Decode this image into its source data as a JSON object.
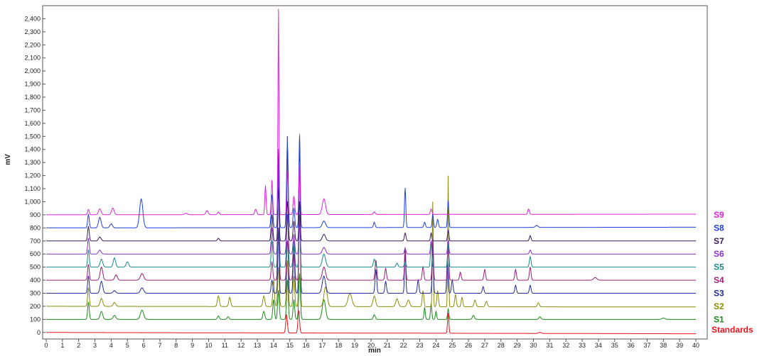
{
  "chart_data": {
    "type": "line",
    "title": "",
    "xlabel": "min",
    "ylabel": "mV",
    "xlim": [
      0,
      40
    ],
    "ylim": [
      -50,
      2500
    ],
    "x_ticks": [
      0,
      1,
      2,
      3,
      4,
      5,
      6,
      7,
      8,
      9,
      10,
      11,
      12,
      13,
      14,
      15,
      16,
      17,
      18,
      19,
      20,
      21,
      22,
      23,
      24,
      25,
      26,
      27,
      28,
      29,
      30,
      31,
      32,
      33,
      34,
      35,
      36,
      37,
      38,
      39,
      40
    ],
    "y_ticks": [
      0,
      100,
      200,
      300,
      400,
      500,
      600,
      700,
      800,
      900,
      1000,
      1100,
      1200,
      1300,
      1400,
      1500,
      1600,
      1700,
      1800,
      1900,
      2000,
      2100,
      2200,
      2300,
      2400
    ],
    "y_tick_labels": [
      "0",
      "100",
      "200",
      "300",
      "400",
      "500",
      "600",
      "700",
      "800",
      "900",
      "1,000",
      "1,100",
      "1,200",
      "1,300",
      "1,400",
      "1,500",
      "1,600",
      "1,700",
      "1,800",
      "1,900",
      "2,000",
      "2,100",
      "2,200",
      "2,300",
      "2,400"
    ],
    "grid": false,
    "legend_placement": "right, at each trace baseline",
    "series": [
      {
        "name": "Standards",
        "color": "#e8141e",
        "baseline": 0,
        "end": -10,
        "peaks": [
          [
            14.8,
            140,
            0.05
          ],
          [
            15.55,
            170,
            0.05
          ],
          [
            24.75,
            150,
            0.04
          ],
          [
            30.4,
            8,
            0.08
          ]
        ]
      },
      {
        "name": "S1",
        "color": "#1a8a1a",
        "baseline": 100,
        "end": 100,
        "peaks": [
          [
            2.6,
            130,
            0.05
          ],
          [
            3.4,
            60,
            0.08
          ],
          [
            4.2,
            30,
            0.08
          ],
          [
            5.9,
            70,
            0.1
          ],
          [
            10.6,
            25,
            0.06
          ],
          [
            11.2,
            20,
            0.06
          ],
          [
            13.4,
            60,
            0.06
          ],
          [
            14.0,
            150,
            0.05
          ],
          [
            14.3,
            220,
            0.05
          ],
          [
            14.85,
            300,
            0.05
          ],
          [
            15.25,
            150,
            0.05
          ],
          [
            15.6,
            350,
            0.05
          ],
          [
            17.1,
            150,
            0.1
          ],
          [
            20.2,
            35,
            0.06
          ],
          [
            23.3,
            90,
            0.04
          ],
          [
            23.7,
            120,
            0.04
          ],
          [
            24.0,
            60,
            0.04
          ],
          [
            24.75,
            80,
            0.04
          ],
          [
            26.3,
            30,
            0.06
          ],
          [
            30.4,
            20,
            0.06
          ],
          [
            38.0,
            10,
            0.1
          ]
        ]
      },
      {
        "name": "S2",
        "color": "#8c8c0a",
        "baseline": 200,
        "end": 195,
        "peaks": [
          [
            2.6,
            140,
            0.05
          ],
          [
            3.4,
            60,
            0.08
          ],
          [
            4.2,
            30,
            0.08
          ],
          [
            10.6,
            80,
            0.06
          ],
          [
            11.3,
            70,
            0.06
          ],
          [
            13.4,
            80,
            0.06
          ],
          [
            14.0,
            200,
            0.05
          ],
          [
            14.3,
            300,
            0.05
          ],
          [
            14.85,
            350,
            0.05
          ],
          [
            15.25,
            230,
            0.05
          ],
          [
            15.6,
            1320,
            0.04
          ],
          [
            17.2,
            150,
            0.1
          ],
          [
            18.7,
            100,
            0.12
          ],
          [
            20.2,
            80,
            0.08
          ],
          [
            21.6,
            60,
            0.08
          ],
          [
            22.3,
            50,
            0.08
          ],
          [
            23.2,
            120,
            0.05
          ],
          [
            23.8,
            800,
            0.03
          ],
          [
            24.1,
            120,
            0.05
          ],
          [
            24.75,
            1000,
            0.03
          ],
          [
            25.2,
            90,
            0.05
          ],
          [
            25.6,
            70,
            0.05
          ],
          [
            26.4,
            50,
            0.06
          ],
          [
            27.1,
            40,
            0.06
          ],
          [
            30.3,
            30,
            0.06
          ]
        ]
      },
      {
        "name": "S3",
        "color": "#1f2e9a",
        "baseline": 300,
        "end": 300,
        "peaks": [
          [
            2.6,
            130,
            0.05
          ],
          [
            3.4,
            90,
            0.08
          ],
          [
            4.2,
            20,
            0.08
          ],
          [
            5.9,
            40,
            0.1
          ],
          [
            13.9,
            100,
            0.05
          ],
          [
            14.3,
            500,
            0.04
          ],
          [
            14.85,
            1200,
            0.04
          ],
          [
            15.25,
            300,
            0.05
          ],
          [
            15.6,
            1200,
            0.04
          ],
          [
            17.1,
            130,
            0.1
          ],
          [
            20.3,
            180,
            0.05
          ],
          [
            20.9,
            90,
            0.05
          ],
          [
            22.1,
            300,
            0.04
          ],
          [
            22.9,
            100,
            0.05
          ],
          [
            23.8,
            350,
            0.04
          ],
          [
            24.7,
            250,
            0.04
          ],
          [
            25.0,
            100,
            0.05
          ],
          [
            26.9,
            50,
            0.05
          ],
          [
            28.9,
            60,
            0.05
          ],
          [
            29.8,
            60,
            0.05
          ]
        ]
      },
      {
        "name": "S4",
        "color": "#9a1f7a",
        "baseline": 400,
        "end": 400,
        "peaks": [
          [
            2.6,
            120,
            0.05
          ],
          [
            3.4,
            100,
            0.08
          ],
          [
            4.3,
            40,
            0.08
          ],
          [
            5.9,
            50,
            0.1
          ],
          [
            13.9,
            140,
            0.05
          ],
          [
            14.3,
            1000,
            0.04
          ],
          [
            14.85,
            300,
            0.05
          ],
          [
            15.25,
            260,
            0.05
          ],
          [
            15.6,
            500,
            0.04
          ],
          [
            17.1,
            100,
            0.1
          ],
          [
            20.3,
            150,
            0.05
          ],
          [
            20.9,
            90,
            0.05
          ],
          [
            22.1,
            250,
            0.04
          ],
          [
            23.2,
            100,
            0.05
          ],
          [
            23.8,
            300,
            0.04
          ],
          [
            24.75,
            250,
            0.04
          ],
          [
            25.5,
            60,
            0.05
          ],
          [
            27.0,
            80,
            0.05
          ],
          [
            28.9,
            80,
            0.05
          ],
          [
            29.8,
            100,
            0.05
          ],
          [
            33.8,
            20,
            0.1
          ]
        ]
      },
      {
        "name": "S5",
        "color": "#1a8a8a",
        "baseline": 500,
        "end": 500,
        "peaks": [
          [
            2.6,
            130,
            0.05
          ],
          [
            3.4,
            60,
            0.08
          ],
          [
            4.2,
            70,
            0.07
          ],
          [
            5.0,
            40,
            0.08
          ],
          [
            13.9,
            200,
            0.05
          ],
          [
            14.3,
            800,
            0.04
          ],
          [
            14.85,
            400,
            0.05
          ],
          [
            15.25,
            200,
            0.05
          ],
          [
            15.6,
            400,
            0.04
          ],
          [
            17.1,
            100,
            0.1
          ],
          [
            20.2,
            60,
            0.06
          ],
          [
            21.6,
            30,
            0.06
          ],
          [
            22.1,
            40,
            0.05
          ],
          [
            23.7,
            200,
            0.04
          ],
          [
            24.75,
            180,
            0.04
          ],
          [
            29.8,
            80,
            0.05
          ]
        ]
      },
      {
        "name": "S6",
        "color": "#8a2fc8",
        "baseline": 600,
        "end": 600,
        "peaks": [
          [
            2.6,
            120,
            0.05
          ],
          [
            3.3,
            30,
            0.08
          ],
          [
            13.9,
            200,
            0.05
          ],
          [
            14.3,
            600,
            0.04
          ],
          [
            14.85,
            300,
            0.05
          ],
          [
            15.25,
            150,
            0.05
          ],
          [
            15.6,
            300,
            0.04
          ],
          [
            17.1,
            50,
            0.1
          ],
          [
            22.1,
            40,
            0.05
          ],
          [
            23.7,
            100,
            0.04
          ],
          [
            24.75,
            100,
            0.04
          ],
          [
            29.8,
            30,
            0.05
          ]
        ]
      },
      {
        "name": "S7",
        "color": "#3a1a5a",
        "baseline": 700,
        "end": 700,
        "peaks": [
          [
            2.6,
            110,
            0.05
          ],
          [
            3.3,
            30,
            0.08
          ],
          [
            10.6,
            20,
            0.06
          ],
          [
            13.9,
            200,
            0.05
          ],
          [
            14.3,
            400,
            0.04
          ],
          [
            14.85,
            300,
            0.05
          ],
          [
            15.25,
            150,
            0.05
          ],
          [
            15.6,
            300,
            0.04
          ],
          [
            17.1,
            50,
            0.1
          ],
          [
            22.1,
            60,
            0.05
          ],
          [
            23.7,
            60,
            0.04
          ],
          [
            24.75,
            80,
            0.04
          ],
          [
            29.8,
            40,
            0.05
          ]
        ]
      },
      {
        "name": "S8",
        "color": "#1f3fe0",
        "baseline": 800,
        "end": 805,
        "peaks": [
          [
            2.6,
            100,
            0.05
          ],
          [
            3.3,
            80,
            0.08
          ],
          [
            4.0,
            30,
            0.08
          ],
          [
            5.85,
            220,
            0.1
          ],
          [
            13.9,
            250,
            0.05
          ],
          [
            14.3,
            550,
            0.04
          ],
          [
            14.85,
            650,
            0.05
          ],
          [
            15.25,
            150,
            0.05
          ],
          [
            15.6,
            700,
            0.04
          ],
          [
            17.1,
            50,
            0.1
          ],
          [
            20.2,
            40,
            0.05
          ],
          [
            22.1,
            300,
            0.04
          ],
          [
            23.3,
            40,
            0.05
          ],
          [
            23.8,
            100,
            0.04
          ],
          [
            24.1,
            60,
            0.05
          ],
          [
            24.75,
            200,
            0.04
          ],
          [
            30.2,
            15,
            0.08
          ]
        ]
      },
      {
        "name": "S9",
        "color": "#e020e0",
        "baseline": 900,
        "end": 905,
        "peaks": [
          [
            2.6,
            40,
            0.05
          ],
          [
            3.3,
            45,
            0.08
          ],
          [
            4.1,
            50,
            0.08
          ],
          [
            8.6,
            10,
            0.1
          ],
          [
            9.9,
            30,
            0.07
          ],
          [
            10.6,
            20,
            0.06
          ],
          [
            12.9,
            40,
            0.06
          ],
          [
            13.5,
            220,
            0.04
          ],
          [
            13.9,
            260,
            0.04
          ],
          [
            14.3,
            1570,
            0.03
          ],
          [
            14.85,
            330,
            0.04
          ],
          [
            15.25,
            140,
            0.05
          ],
          [
            15.6,
            400,
            0.04
          ],
          [
            17.1,
            120,
            0.1
          ],
          [
            20.2,
            20,
            0.06
          ],
          [
            23.7,
            40,
            0.05
          ],
          [
            29.7,
            40,
            0.05
          ]
        ]
      }
    ]
  }
}
